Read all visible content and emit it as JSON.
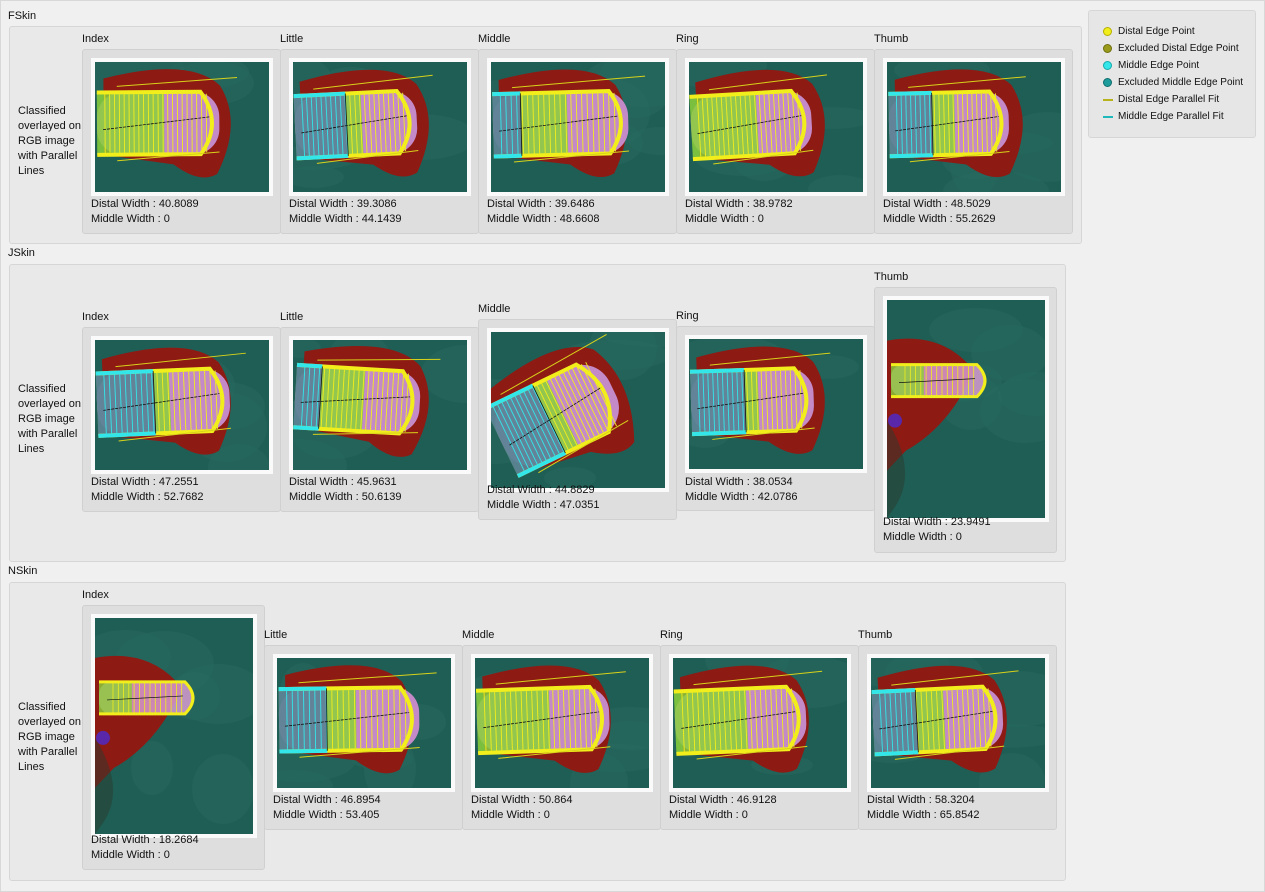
{
  "legend": [
    {
      "label": "Distal Edge Point",
      "kind": "dot",
      "color": "#f2ee1c"
    },
    {
      "label": "Excluded Distal Edge Point",
      "kind": "dot",
      "color": "#9a9a1a"
    },
    {
      "label": "Middle Edge Point",
      "kind": "dot",
      "color": "#33e6ea"
    },
    {
      "label": "Excluded Middle Edge Point",
      "kind": "dot",
      "color": "#1e9c9c"
    },
    {
      "label": "Distal Edge Parallel Fit",
      "kind": "line",
      "color": "#b8b31a"
    },
    {
      "label": "Middle Edge Parallel Fit",
      "kind": "line",
      "color": "#1fb9bb"
    }
  ],
  "row_label": "Classified overlayed on RGB image with Parallel Lines",
  "distal_prefix": "Distal Width : ",
  "middle_prefix": "Middle Width : ",
  "sections": [
    {
      "title": "FSkin",
      "fingers": [
        {
          "name": "Index",
          "distal": "40.8089",
          "middle": "0"
        },
        {
          "name": "Little",
          "distal": "39.3086",
          "middle": "44.1439"
        },
        {
          "name": "Middle",
          "distal": "39.6486",
          "middle": "48.6608"
        },
        {
          "name": "Ring",
          "distal": "38.9782",
          "middle": "0"
        },
        {
          "name": "Thumb",
          "distal": "48.5029",
          "middle": "55.2629"
        }
      ]
    },
    {
      "title": "JSkin",
      "fingers": [
        {
          "name": "Index",
          "distal": "47.2551",
          "middle": "52.7682"
        },
        {
          "name": "Little",
          "distal": "45.9631",
          "middle": "50.6139"
        },
        {
          "name": "Middle",
          "distal": "44.8829",
          "middle": "47.0351"
        },
        {
          "name": "Ring",
          "distal": "38.0534",
          "middle": "42.0786"
        },
        {
          "name": "Thumb",
          "distal": "23.9491",
          "middle": "0"
        }
      ]
    },
    {
      "title": "NSkin",
      "fingers": [
        {
          "name": "Index",
          "distal": "18.2684",
          "middle": "0"
        },
        {
          "name": "Little",
          "distal": "46.8954",
          "middle": "53.405"
        },
        {
          "name": "Middle",
          "distal": "50.864",
          "middle": "0"
        },
        {
          "name": "Ring",
          "distal": "46.9128",
          "middle": "0"
        },
        {
          "name": "Thumb",
          "distal": "58.3204",
          "middle": "65.8542"
        }
      ]
    }
  ]
}
